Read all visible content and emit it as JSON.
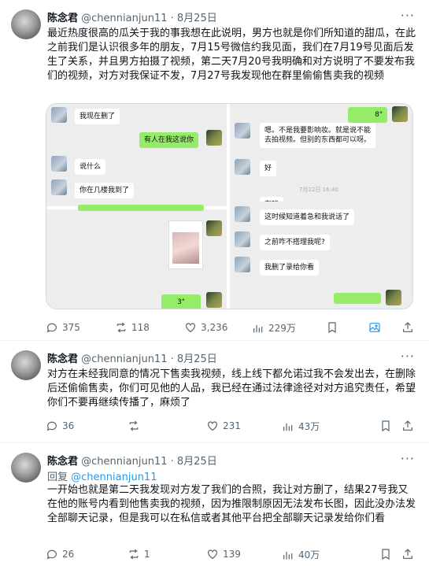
{
  "tweets": [
    {
      "author": "陈念君",
      "handle": "@chennianjun11",
      "sep": "·",
      "date": "8月25日",
      "text": "最近热度很高的瓜关于我的事我想在此说明，男方也就是你们所知道的甜瓜，在此之前我们是认识很多年的朋友，7月15号微信约我见面，我们在7月19号见面后发生了关系，并且男方拍摄了视频，第二天7月20号我明确和对方说明了不要发布我们的视频，对方对我保证不发，7月27号我发现他在群里偷偷售卖我的视频",
      "stats": {
        "replies": "375",
        "retweets": "118",
        "likes": "3,236",
        "views": "229万"
      }
    },
    {
      "author": "陈念君",
      "handle": "@chennianjun11",
      "sep": "·",
      "date": "8月25日",
      "text": "对方在未经我同意的情况下售卖我视频，线上线下都允诺过我不会发出去，在删除后还偷偷售卖，你们可见他的人品，我已经在通过法律途径对对方追究责任，希望你们不要再继续传播了，麻烦了",
      "stats": {
        "replies": "36",
        "retweets": "",
        "likes": "231",
        "views": "43万"
      }
    },
    {
      "author": "陈念君",
      "handle": "@chennianjun11",
      "sep": "·",
      "date": "8月25日",
      "reply_prefix": "回复",
      "reply_handle": "@chennianjun11",
      "text": "一开始也就是第二天我发现对方发了我们的合照，我让对方删了，结果27号我又在他的账号内看到他售卖我的视频，因为推限制原因无法发布长图，因此没办法发全部聊天记录，但是我可以在私信或者其他平台把全部聊天记录发给你们看",
      "stats": {
        "replies": "26",
        "retweets": "1",
        "likes": "139",
        "views": "40万"
      }
    }
  ],
  "chat": {
    "a1": "我现在删了",
    "a2": "有人在我这说你",
    "a3": "说什么",
    "a4": "你在几楼我到了",
    "a5": "3\"",
    "b0": "8\"",
    "b1": "嗯。不是我要影响妆。就是说不能",
    "b2": "去拍视频。但别的东西都可以呀。",
    "b3": "好",
    "b4": "7月22日 16:40",
    "b5": "这时候知道着急和我说话了",
    "b6": "之前咋不搭理我呢?",
    "b7": "我删了录给你看",
    "b8": "在吗"
  }
}
